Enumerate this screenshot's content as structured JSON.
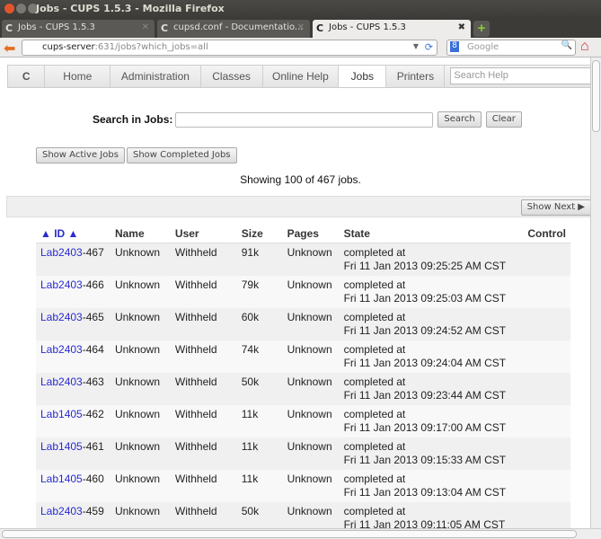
{
  "window": {
    "title": "Jobs - CUPS 1.5.3 - Mozilla Firefox"
  },
  "tabs": [
    {
      "label": "Jobs - CUPS 1.5.3"
    },
    {
      "label": "cupsd.conf - Documentatio..."
    },
    {
      "label": "Jobs - CUPS 1.5.3"
    }
  ],
  "navbar": {
    "url_host": "cups-server",
    "url_rest": ":631/jobs?which_jobs=all",
    "search_placeholder": "Google"
  },
  "cups_nav": {
    "items": [
      "Home",
      "Administration",
      "Classes",
      "Online Help",
      "Jobs",
      "Printers"
    ],
    "active": "Jobs",
    "search_placeholder": "Search Help"
  },
  "search": {
    "label": "Search in Jobs:",
    "value": "",
    "search_button": "Search",
    "clear_button": "Clear"
  },
  "filters": {
    "active": "Show Active Jobs",
    "completed": "Show Completed Jobs"
  },
  "showing": "Showing 100 of 467 jobs.",
  "show_next": "Show Next ▶",
  "table": {
    "headers": {
      "id": "▲ ID ▲",
      "name": "Name",
      "user": "User",
      "size": "Size",
      "pages": "Pages",
      "state": "State",
      "control": "Control"
    },
    "rows": [
      {
        "printer": "Lab2403",
        "num": "-467",
        "name": "Unknown",
        "user": "Withheld",
        "size": "91k",
        "pages": "Unknown",
        "state": "completed at",
        "time": "Fri 11 Jan 2013 09:25:25 AM CST"
      },
      {
        "printer": "Lab2403",
        "num": "-466",
        "name": "Unknown",
        "user": "Withheld",
        "size": "79k",
        "pages": "Unknown",
        "state": "completed at",
        "time": "Fri 11 Jan 2013 09:25:03 AM CST"
      },
      {
        "printer": "Lab2403",
        "num": "-465",
        "name": "Unknown",
        "user": "Withheld",
        "size": "60k",
        "pages": "Unknown",
        "state": "completed at",
        "time": "Fri 11 Jan 2013 09:24:52 AM CST"
      },
      {
        "printer": "Lab2403",
        "num": "-464",
        "name": "Unknown",
        "user": "Withheld",
        "size": "74k",
        "pages": "Unknown",
        "state": "completed at",
        "time": "Fri 11 Jan 2013 09:24:04 AM CST"
      },
      {
        "printer": "Lab2403",
        "num": "-463",
        "name": "Unknown",
        "user": "Withheld",
        "size": "50k",
        "pages": "Unknown",
        "state": "completed at",
        "time": "Fri 11 Jan 2013 09:23:44 AM CST"
      },
      {
        "printer": "Lab1405",
        "num": "-462",
        "name": "Unknown",
        "user": "Withheld",
        "size": "11k",
        "pages": "Unknown",
        "state": "completed at",
        "time": "Fri 11 Jan 2013 09:17:00 AM CST"
      },
      {
        "printer": "Lab1405",
        "num": "-461",
        "name": "Unknown",
        "user": "Withheld",
        "size": "11k",
        "pages": "Unknown",
        "state": "completed at",
        "time": "Fri 11 Jan 2013 09:15:33 AM CST"
      },
      {
        "printer": "Lab1405",
        "num": "-460",
        "name": "Unknown",
        "user": "Withheld",
        "size": "11k",
        "pages": "Unknown",
        "state": "completed at",
        "time": "Fri 11 Jan 2013 09:13:04 AM CST"
      },
      {
        "printer": "Lab2403",
        "num": "-459",
        "name": "Unknown",
        "user": "Withheld",
        "size": "50k",
        "pages": "Unknown",
        "state": "completed at",
        "time": "Fri 11 Jan 2013 09:11:05 AM CST"
      }
    ]
  }
}
